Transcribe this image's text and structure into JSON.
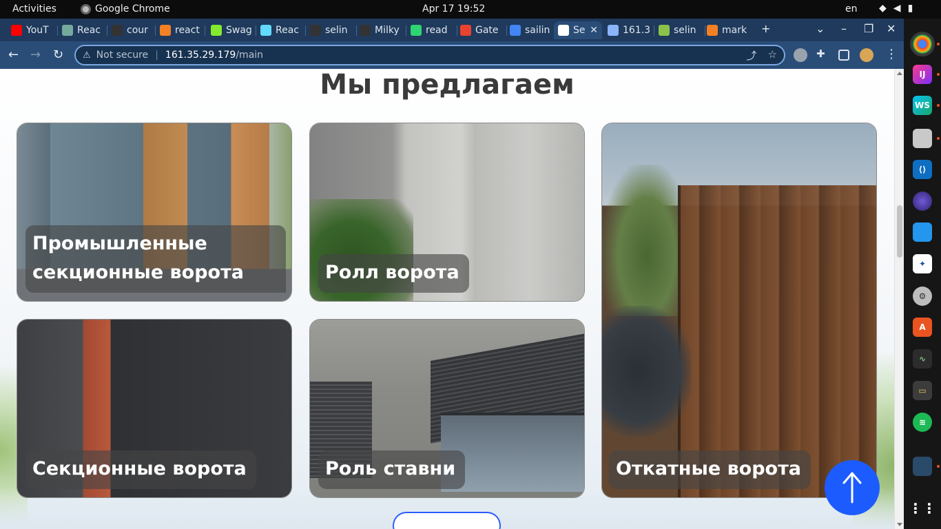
{
  "topbar": {
    "activities": "Activities",
    "app_name": "Google Chrome",
    "clock": "Apr 17  19:52",
    "lang": "en"
  },
  "tabs": [
    {
      "label": "YouT",
      "color": "#ff0000"
    },
    {
      "label": "Reac",
      "color": "#74aa9c"
    },
    {
      "label": "cour",
      "color": "#333333"
    },
    {
      "label": "react",
      "color": "#f48024"
    },
    {
      "label": "Swag",
      "color": "#85ea2d"
    },
    {
      "label": "Reac",
      "color": "#61dafb"
    },
    {
      "label": "selin",
      "color": "#333333"
    },
    {
      "label": "Milky",
      "color": "#333333"
    },
    {
      "label": "read",
      "color": "#2ed573"
    },
    {
      "label": "Gate",
      "color": "#e8432e"
    },
    {
      "label": "sailin",
      "color": "#4285f4"
    },
    {
      "label": "Se",
      "color": "#ffffff",
      "active": true
    },
    {
      "label": "161.3",
      "color": "#8ab4f8"
    },
    {
      "label": "selin",
      "color": "#8bc34a"
    },
    {
      "label": "mark",
      "color": "#f48024"
    }
  ],
  "omnibox": {
    "security": "Not secure",
    "host": "161.35.29.179",
    "path": "/main"
  },
  "page": {
    "title": "Мы предлагаем",
    "cards": [
      {
        "label_line1": "Промышленные",
        "label_line2": "секционные ворота"
      },
      {
        "label": "Ролл ворота"
      },
      {
        "label": "Откатные ворота"
      },
      {
        "label": "Секционные ворота"
      },
      {
        "label": "Роль ставни"
      }
    ]
  },
  "icons": {
    "back": "arrow-left-icon",
    "forward": "arrow-right-icon",
    "reload": "reload-icon",
    "share": "share-icon",
    "star": "star-icon",
    "scroll_top": "arrow-up-icon"
  },
  "colors": {
    "accent": "#1c5cff",
    "tab_strip": "#1f3a5c",
    "toolbar": "#2a4d78"
  }
}
